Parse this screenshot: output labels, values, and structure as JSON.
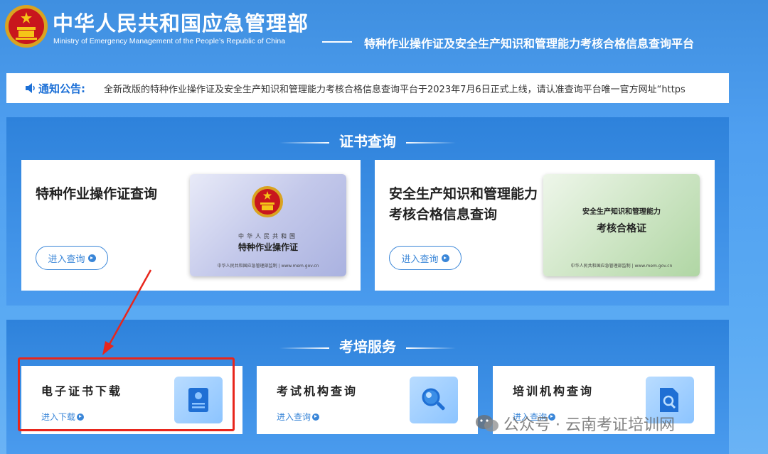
{
  "header": {
    "ministry_cn": "中华人民共和国应急管理部",
    "ministry_en": "Ministry of Emergency Management of the People’s Republic of China",
    "platform_title": "特种作业操作证及安全生产知识和管理能力考核合格信息查询平台"
  },
  "notice": {
    "label": "通知公告:",
    "text": "全新改版的特种作业操作证及安全生产知识和管理能力考核合格信息查询平台于2023年7月6日正式上线，请认准查询平台唯一官方网址“https"
  },
  "cert_section": {
    "title": "证书查询",
    "cards": [
      {
        "title": "特种作业操作证查询",
        "button": "进入查询",
        "image": {
          "country": "中华人民共和国",
          "name": "特种作业操作证",
          "footer": "中华人民共和国应急管理部监制 | www.mem.gov.cn"
        }
      },
      {
        "title_line1": "安全生产知识和管理能力",
        "title_line2": "考核合格信息查询",
        "button": "进入查询",
        "image": {
          "top": "安全生产知识和管理能力",
          "name": "考核合格证",
          "footer": "中华人民共和国应急管理部监制 | www.mem.gov.cn"
        }
      }
    ]
  },
  "service_section": {
    "title": "考培服务",
    "cards": [
      {
        "title": "电子证书下载",
        "link": "进入下载",
        "icon": "certificate-icon"
      },
      {
        "title": "考试机构查询",
        "link": "进入查询",
        "icon": "magnifier-icon"
      },
      {
        "title": "培训机构查询",
        "link": "进入查询",
        "icon": "document-search-icon"
      }
    ]
  },
  "watermark": "公众号 · 云南考证培训网",
  "colors": {
    "accent": "#3a86d8",
    "highlight": "#e8261c",
    "background": "#4f9ff0"
  }
}
